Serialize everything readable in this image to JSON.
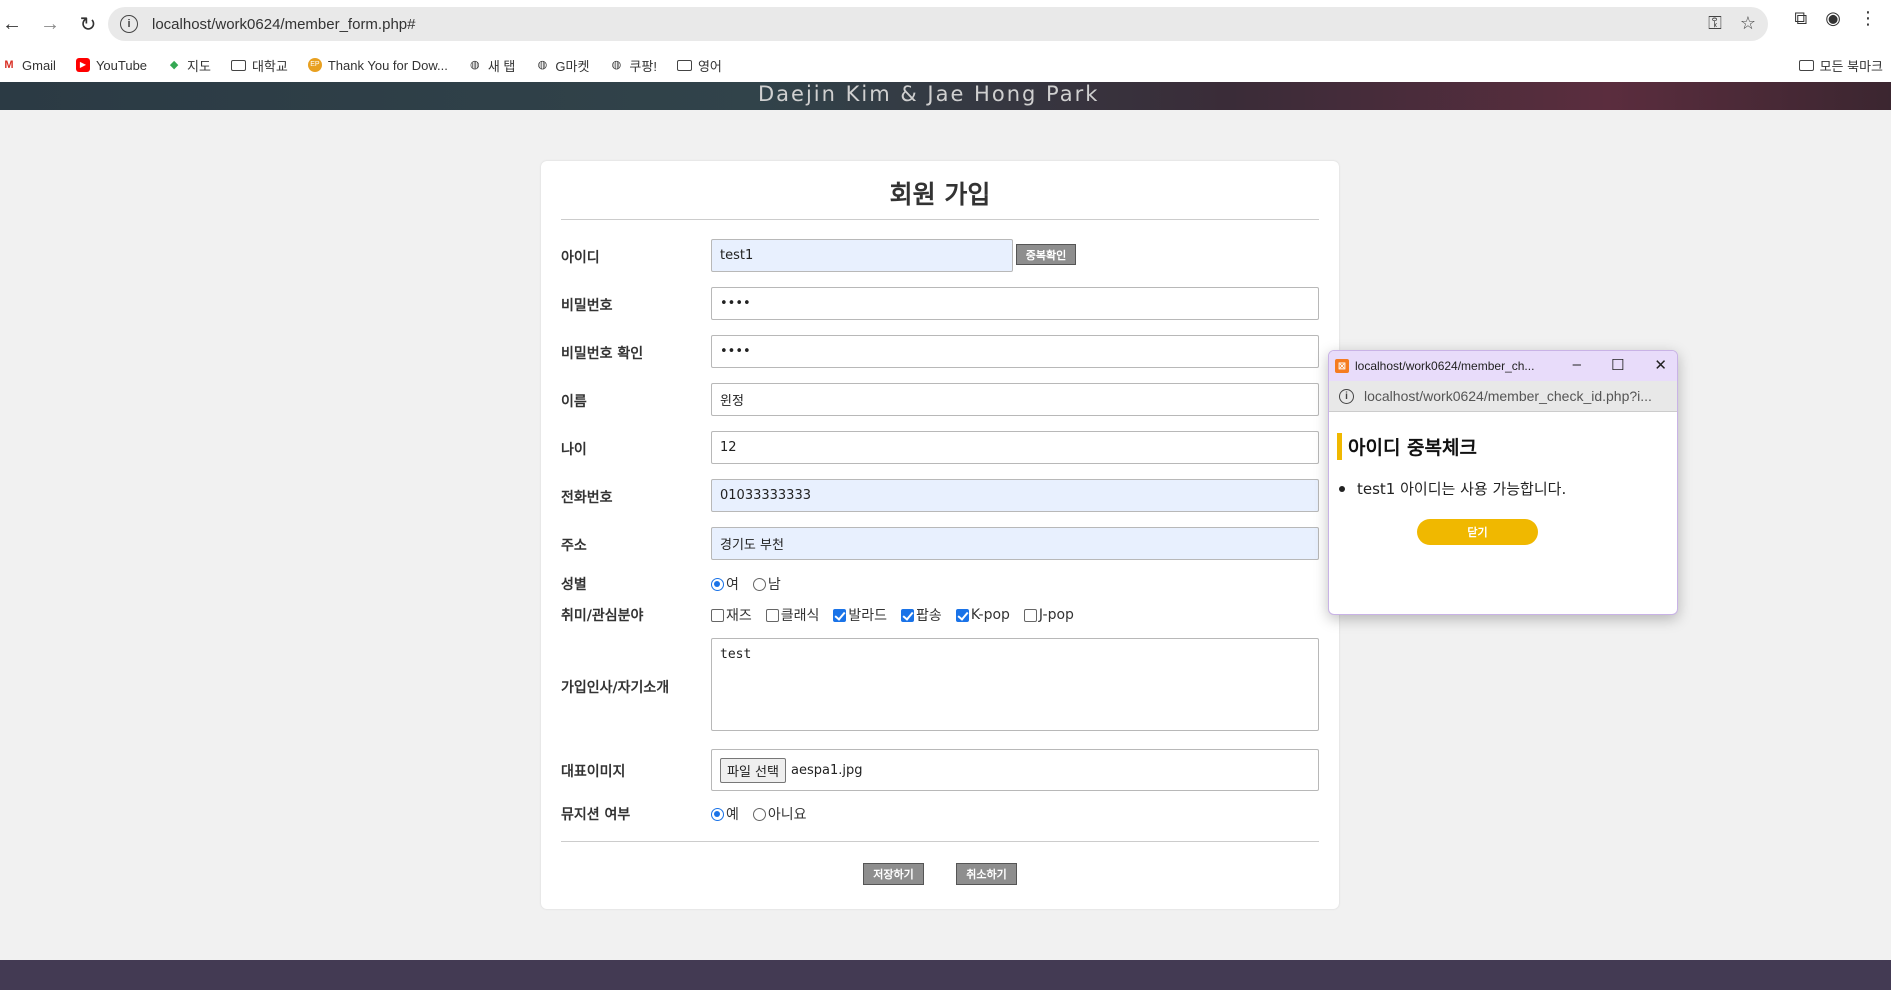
{
  "browser": {
    "url": "localhost/work0624/member_form.php#",
    "bookmarks": [
      {
        "label": "Gmail",
        "icon": "gmail-icon"
      },
      {
        "label": "YouTube",
        "icon": "youtube-icon"
      },
      {
        "label": "지도",
        "icon": "maps-icon"
      },
      {
        "label": "대학교",
        "icon": "folder-icon"
      },
      {
        "label": "Thank You for Dow...",
        "icon": "site-icon"
      },
      {
        "label": "새 탭",
        "icon": "globe-icon"
      },
      {
        "label": "G마켓",
        "icon": "globe-icon"
      },
      {
        "label": "쿠팡!",
        "icon": "globe-icon"
      },
      {
        "label": "영어",
        "icon": "folder-icon"
      }
    ],
    "all_bookmarks_label": "모든 북마크"
  },
  "banner": {
    "text": "Daejin Kim & Jae Hong Park"
  },
  "form": {
    "title": "회원 가입",
    "fields": {
      "id_label": "아이디",
      "id_value": "test1",
      "dup_check_label": "중복확인",
      "password_label": "비밀번호",
      "password_value": "••••",
      "password_confirm_label": "비밀번호 확인",
      "password_confirm_value": "••••",
      "name_label": "이름",
      "name_value": "윈정",
      "age_label": "나이",
      "age_value": "12",
      "phone_label": "전화번호",
      "phone_value": "01033333333",
      "address_label": "주소",
      "address_value": "경기도 부천",
      "gender_label": "성별",
      "gender_female": "여",
      "gender_male": "남",
      "hobby_label": "취미/관심분야",
      "hobbies": [
        "재즈",
        "클래식",
        "발라드",
        "팝송",
        "K-pop",
        "J-pop"
      ],
      "intro_label": "가입인사/자기소개",
      "intro_value": "test",
      "image_label": "대표이미지",
      "file_button": "파일 선택",
      "file_name": "aespa1.jpg",
      "musician_label": "뮤지션 여부",
      "musician_yes": "예",
      "musician_no": "아니요"
    },
    "save_label": "저장하기",
    "cancel_label": "취소하기"
  },
  "popup": {
    "title": "localhost/work0624/member_ch...",
    "url": "localhost/work0624/member_check_id.php?i...",
    "heading": "아이디 중복체크",
    "message": "test1 아이디는 사용 가능합니다.",
    "close_label": "닫기"
  },
  "colors": {
    "accent": "#f0b800",
    "footer": "#433a53",
    "popup_titlebar": "#e8dcfa"
  }
}
